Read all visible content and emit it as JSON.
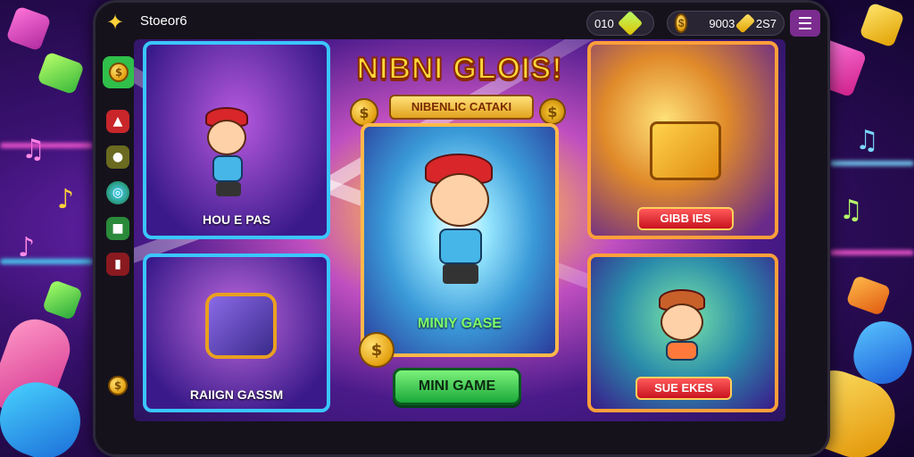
{
  "topbar": {
    "title": "Stoeor6",
    "currency_a": "010",
    "currency_b": "9003",
    "currency_c": "2S7"
  },
  "headline": "NIBNI GLOIS!",
  "sub_banner": "NIBENLIC CATAKI",
  "cards": {
    "top_left": "HOU E PAS",
    "bottom_left": "RAIIGN GASSM",
    "center": "MINIY GASE",
    "top_right_button": "GIBB IES",
    "bottom_right_button": "SUE EKES"
  },
  "mini_button": "MINI GAME",
  "colors": {
    "accent_orange": "#ff9f3a",
    "accent_green": "#1aa83a",
    "accent_gold": "#ffd83a",
    "accent_red": "#d8262a",
    "menu_purple": "#7b2c8f"
  },
  "icons": {
    "star": "star-icon",
    "coin": "coin-icon",
    "gem": "gem-icon",
    "menu": "menu-icon"
  }
}
